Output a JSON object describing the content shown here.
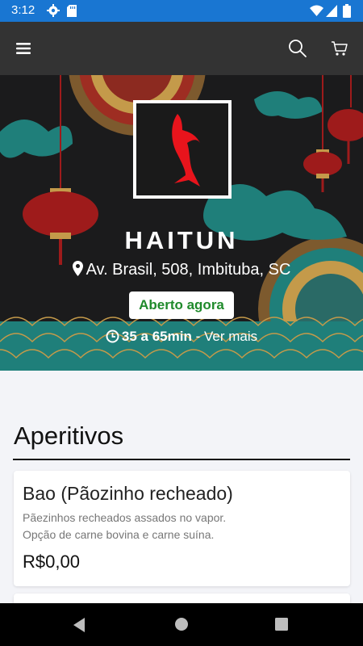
{
  "status_bar": {
    "time": "3:12",
    "icons": [
      "gear-icon",
      "sd-card-icon",
      "wifi-icon",
      "signal-icon",
      "battery-icon"
    ]
  },
  "app_bar": {
    "icons": [
      "menu-icon",
      "search-icon",
      "cart-icon"
    ],
    "background": "#333333"
  },
  "restaurant": {
    "name": "HAITUN",
    "address": "Av. Brasil, 508, Imbituba, SC",
    "status": "Aberto agora",
    "delivery_time": "35 a 65min",
    "more_link": "- Ver mais",
    "logo": "red-dolphin-logo",
    "status_color": "#1f8a2b"
  },
  "menu": {
    "section_title": "Aperitivos",
    "items": [
      {
        "name": "Bao (Pãozinho recheado)",
        "description_line1": "Pãezinhos recheados assados no vapor.",
        "description_line2": "Opção de carne bovina e carne suína.",
        "price": "R$0,00"
      }
    ]
  },
  "navigation_bar": {
    "icons": [
      "back-icon",
      "home-icon",
      "recents-icon"
    ]
  },
  "colors": {
    "status_bar": "#1976d2",
    "logo_red": "#e8141c",
    "teal": "#1f7f7a",
    "lantern_red": "#9e1b1b"
  }
}
